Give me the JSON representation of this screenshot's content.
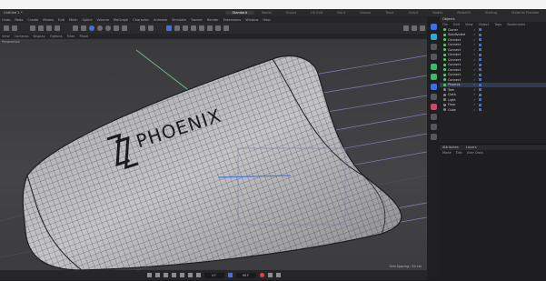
{
  "title_bar": {
    "project": "Untitled 1 *",
    "tabs": [
      "Standard",
      "Model",
      "Sculpt",
      "UV Edit",
      "Paint",
      "Groom",
      "Track",
      "Script",
      "Nodes",
      "Redshift",
      "Startup",
      "Material Preview"
    ],
    "active_tab": "Standard"
  },
  "menu": [
    "Undo",
    "Redo",
    "Create",
    "Modes",
    "Edit",
    "Mesh",
    "Spline",
    "Volume",
    "MoGraph",
    "Character",
    "Animate",
    "Simulate",
    "Tracker",
    "Render",
    "Extensions",
    "Window",
    "Help"
  ],
  "viewport": {
    "menu": [
      "View",
      "Cameras",
      "Display",
      "Options",
      "Filter",
      "Panel"
    ],
    "camera_label": "Perspective",
    "footer": "Grid Spacing : 50 cm",
    "logo_text": "PHOENIX"
  },
  "object_manager": {
    "title": "Objects",
    "menu": [
      "File",
      "Edit",
      "View",
      "Object",
      "Tags",
      "Bookmarks"
    ],
    "objects": [
      {
        "name": "Cloner",
        "active": true
      },
      {
        "name": "Subdivided",
        "active": true
      },
      {
        "name": "Connect",
        "active": true
      },
      {
        "name": "Connect",
        "active": true
      },
      {
        "name": "Connect",
        "active": true
      },
      {
        "name": "Connect",
        "active": true
      },
      {
        "name": "Connect",
        "active": true
      },
      {
        "name": "Connect",
        "active": true
      },
      {
        "name": "Connect",
        "active": true
      },
      {
        "name": "Connect",
        "active": true
      },
      {
        "name": "Connect",
        "active": true
      },
      {
        "name": "Phoenix",
        "active": true,
        "selected": true
      },
      {
        "name": "Text",
        "active": false
      },
      {
        "name": "Cloth",
        "active": false
      },
      {
        "name": "Light",
        "active": false
      },
      {
        "name": "Floor",
        "active": false
      },
      {
        "name": "Cube",
        "active": false
      }
    ]
  },
  "attributes": {
    "tabs": [
      "Attributes",
      "Layers"
    ],
    "menu": [
      "Mode",
      "Edit",
      "User Data"
    ]
  },
  "timeline": {
    "frame_current": "0 F",
    "frame_end": "90 F"
  },
  "colors": {
    "accent": "#4a6fd4",
    "active_green": "#5bd06b",
    "viewport_bg": "#404042"
  }
}
